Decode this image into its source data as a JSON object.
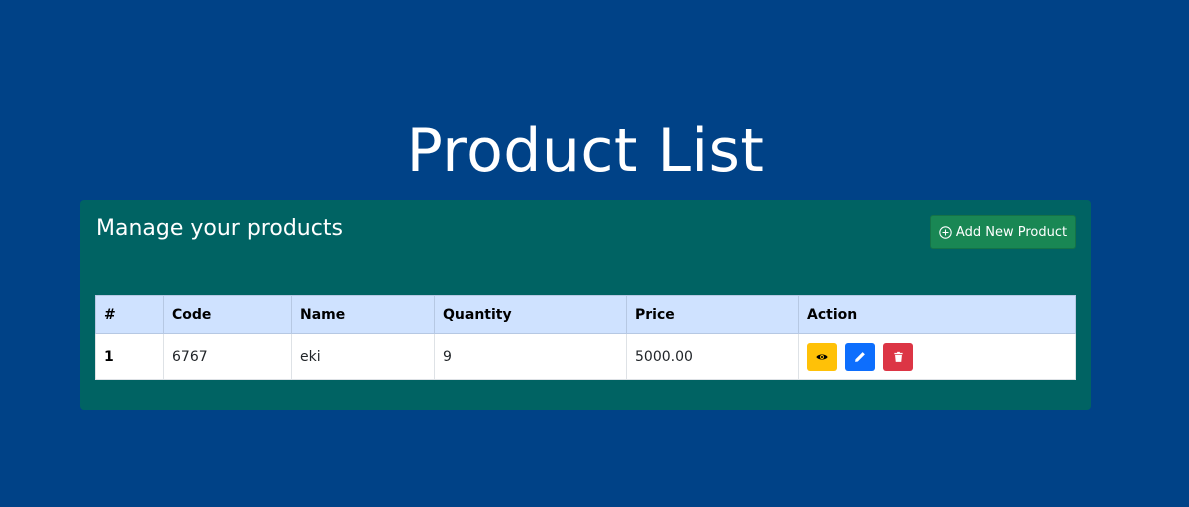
{
  "page": {
    "title": "Product List"
  },
  "card": {
    "heading": "Manage your products",
    "add_button_label": "Add New Product"
  },
  "table": {
    "headers": [
      "#",
      "Code",
      "Name",
      "Quantity",
      "Price",
      "Action"
    ],
    "rows": [
      {
        "index": "1",
        "code": "6767",
        "name": "eki",
        "quantity": "9",
        "price": "5000.00",
        "actions": [
          "eye-icon",
          "pencil-icon",
          "trash-icon"
        ]
      }
    ]
  },
  "colors": {
    "background": "#004287",
    "card": "#006363",
    "add_button": "#198754",
    "table_header": "#cfe2ff",
    "view_button": "#ffc107",
    "edit_button": "#0d6efd",
    "delete_button": "#dc3545"
  }
}
